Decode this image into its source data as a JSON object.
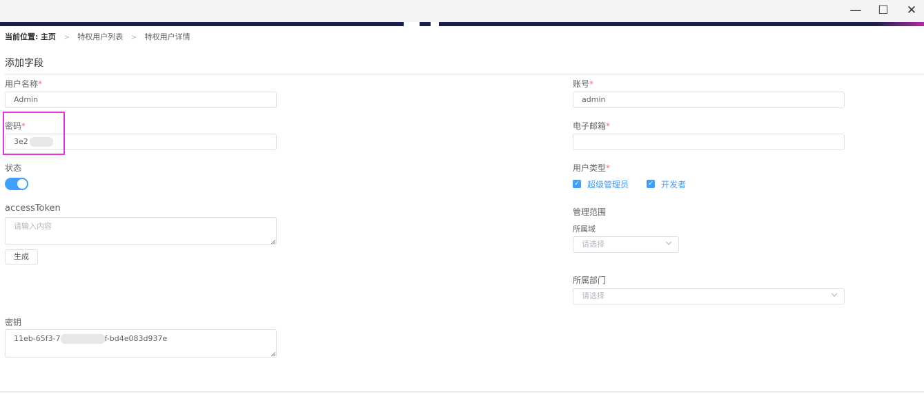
{
  "window": {
    "minimize": "—",
    "maximize": "☐",
    "close": "✕"
  },
  "breadcrumb": {
    "prefix": "当前位置:",
    "home": "主页",
    "level1": "特权用户列表",
    "level2": "特权用户详情",
    "separator": ">"
  },
  "section_title": "添加字段",
  "form": {
    "username": {
      "label": "用户名称",
      "required": "*",
      "value": "Admin"
    },
    "account": {
      "label": "账号",
      "required": "*",
      "value": "admin"
    },
    "password": {
      "label": "密码",
      "required": "*",
      "value": "3e2"
    },
    "email": {
      "label": "电子邮箱",
      "required": "*",
      "value": ""
    },
    "status": {
      "label": "状态",
      "on": true
    },
    "user_type": {
      "label": "用户类型",
      "required": "*",
      "options": [
        {
          "label": "超级管理员",
          "checked": true
        },
        {
          "label": "开发者",
          "checked": true
        }
      ]
    },
    "access_token": {
      "label": "accessToken",
      "placeholder": "请输入内容",
      "generate_button": "生成"
    },
    "scope": {
      "label": "管理范围",
      "domain_label": "所属域",
      "domain_placeholder": "请选择",
      "department_label": "所属部门",
      "department_placeholder": "请选择"
    },
    "secret_key": {
      "label": "密钥",
      "value_prefix": "11eb-65f3-7",
      "value_suffix": "f-bd4e083d937e"
    }
  },
  "colors": {
    "primary": "#409eff",
    "required": "#f56c6c",
    "highlight": "#e533e1",
    "header_strip": "#1c1f4c"
  }
}
